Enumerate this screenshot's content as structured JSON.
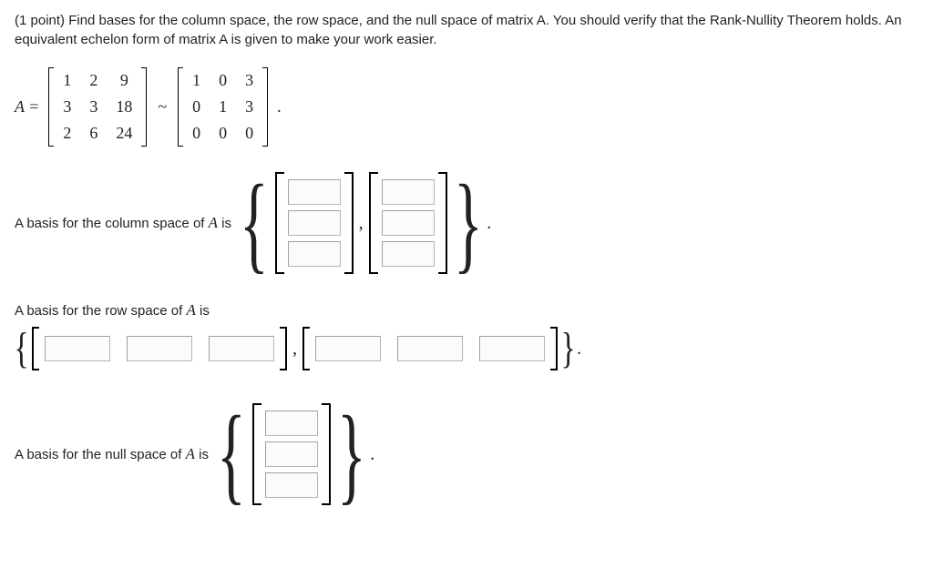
{
  "problem": {
    "points": "(1 point)",
    "text": "Find bases for the column space, the row space, and the null space of matrix A. You should verify that the Rank-Nullity Theorem holds. An equivalent echelon form of matrix A is given to make your work easier."
  },
  "matrix_eq": {
    "label": "A =",
    "tilde": "~",
    "period": ".",
    "A": [
      [
        "1",
        "2",
        "9"
      ],
      [
        "3",
        "3",
        "18"
      ],
      [
        "2",
        "6",
        "24"
      ]
    ],
    "E": [
      [
        "1",
        "0",
        "3"
      ],
      [
        "0",
        "1",
        "3"
      ],
      [
        "0",
        "0",
        "0"
      ]
    ]
  },
  "labels": {
    "col_space": "A basis for the column space of ",
    "row_space": "A basis for the row space of ",
    "null_space": "A basis for the null space of ",
    "A_is": " is",
    "A": "A"
  },
  "symbols": {
    "lbrace": "{",
    "rbrace": "}",
    "comma": ",",
    "period": "."
  }
}
